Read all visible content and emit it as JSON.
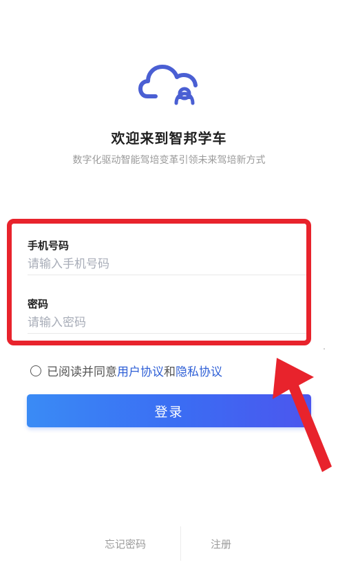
{
  "header": {
    "title": "欢迎来到智邦学车",
    "subtitle": "数字化驱动智能驾培变革引领未来驾培新方式"
  },
  "form": {
    "phone_label": "手机号码",
    "phone_placeholder": "请输入手机号码",
    "password_label": "密码",
    "password_placeholder": "请输入密码"
  },
  "agreement": {
    "prefix": "已阅读并同意",
    "user_agreement": "用户协议",
    "connector": "和",
    "privacy_policy": "隐私协议"
  },
  "login_button": "登录",
  "footer": {
    "forgot_password": "忘记密码",
    "register": "注册"
  },
  "colors": {
    "primary": "#3b6cf3",
    "link": "#2e5fd6",
    "highlight": "#e8232c",
    "logo": "#4a5fd3"
  },
  "icons": {
    "logo": "cloud-car-logo-icon",
    "radio": "radio-unchecked-icon",
    "annotation": "red-arrow-annotation"
  }
}
